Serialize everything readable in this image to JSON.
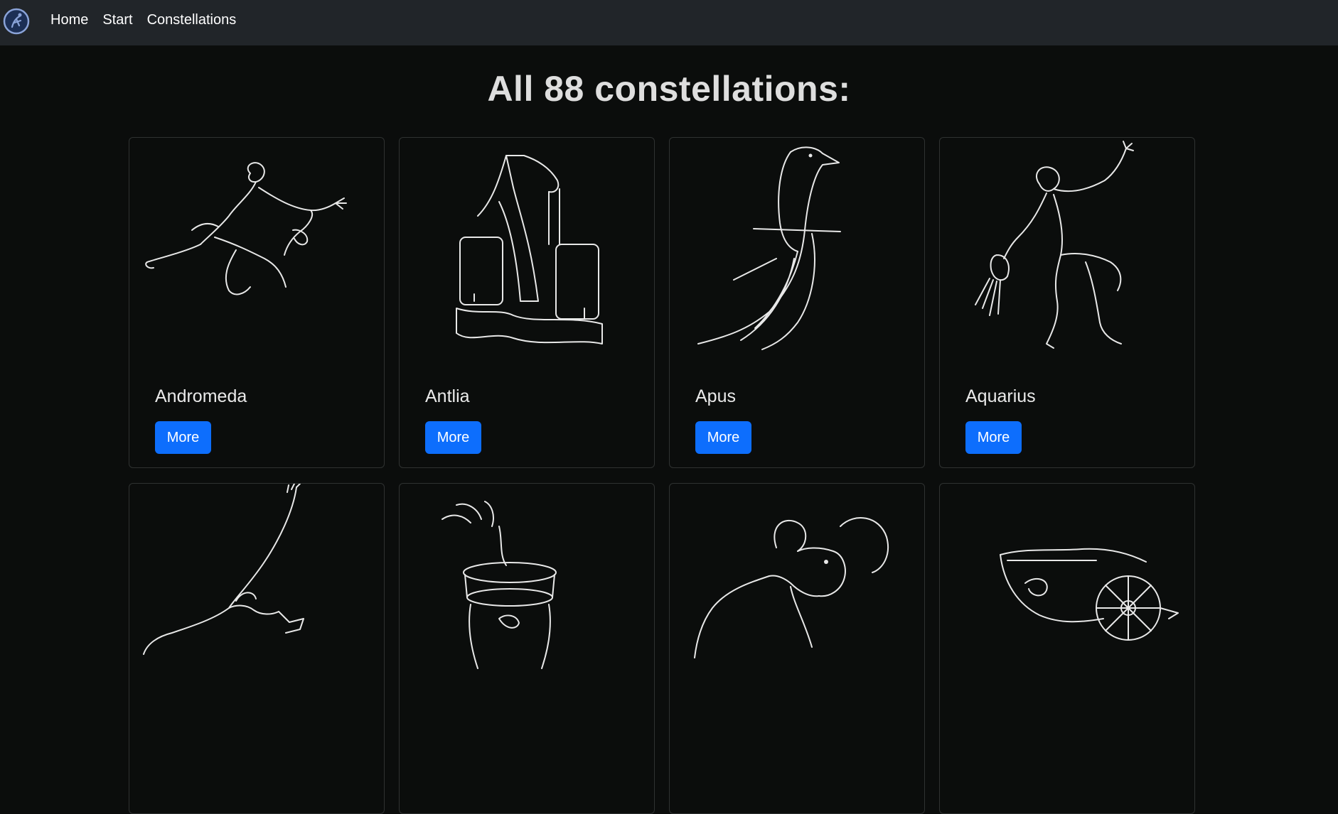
{
  "navbar": {
    "logo_icon": "astronomy-logo-icon",
    "links": [
      {
        "label": "Home"
      },
      {
        "label": "Start"
      },
      {
        "label": "Constellations"
      }
    ]
  },
  "page": {
    "title": "All 88 constellations:"
  },
  "constellations": [
    {
      "name": "Andromeda",
      "button": "More",
      "icon": "andromeda-illustration-icon"
    },
    {
      "name": "Antlia",
      "button": "More",
      "icon": "air-pump-illustration-icon"
    },
    {
      "name": "Apus",
      "button": "More",
      "icon": "bird-of-paradise-illustration-icon"
    },
    {
      "name": "Aquarius",
      "button": "More",
      "icon": "water-bearer-illustration-icon"
    },
    {
      "name": "",
      "button": "",
      "icon": "eagle-illustration-icon"
    },
    {
      "name": "",
      "button": "",
      "icon": "altar-illustration-icon"
    },
    {
      "name": "",
      "button": "",
      "icon": "ram-illustration-icon"
    },
    {
      "name": "",
      "button": "",
      "icon": "chariot-illustration-icon"
    }
  ],
  "colors": {
    "background": "#0b0d0c",
    "navbar": "#212529",
    "button": "#0d6efd",
    "card_border": "#2f3231"
  }
}
